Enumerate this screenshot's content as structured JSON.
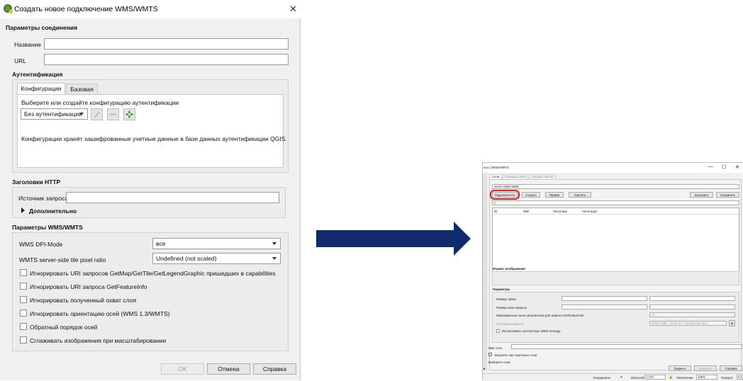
{
  "dialog": {
    "title": "Создать новое подключение WMS/WMTS",
    "connection_params": {
      "header": "Параметры соединения",
      "name_label": "Название",
      "name_value": "",
      "url_label": "URL",
      "url_value": ""
    },
    "auth": {
      "header": "Аутентификация",
      "tabs": [
        "Конфигурации",
        "Базовая"
      ],
      "choose_text": "Выберите или создайте конфигурацию аутентификации",
      "combo_value": "Без аутентификации",
      "info_text": "Конфигурации хранят зашифрованные учетные данные в базе данных аутентификации QGIS."
    },
    "http": {
      "header": "Заголовки HTTP",
      "referer_label": "Источник запроса",
      "referer_value": "",
      "more_label": "Дополнительно"
    },
    "wms": {
      "header": "Параметры WMS/WMTS",
      "dpi_label": "WMS DPI-Mode",
      "dpi_value": "все",
      "ratio_label": "WMTS server-side tile pixel ratio",
      "ratio_value": "Undefined (not scaled)",
      "checks": [
        "Игнорировать URI запросов GetMap/GetTile/GetLegendGraphic пришедших в capabilities",
        "Игнорировать URI запроса GetFeatureInfo",
        "Игнорировать полученный охват слоя",
        "Игнорировать ориентацию осей (WMS 1.3/WMTS)",
        "Обратный порядок осей",
        "Сглаживать изображения при масштабировании"
      ]
    },
    "buttons": {
      "ok": "OK",
      "cancel": "Отмена",
      "help": "Справка"
    }
  },
  "thumb": {
    "title": "ных | WMS/WMTS",
    "tabs": [
      "Слои",
      "Порядок слоёв",
      "Наборы тайлов"
    ],
    "server": "NASA GIBS WMS",
    "buttons": {
      "connect": "Подключиться",
      "create": "Создать",
      "edit": "Правка",
      "delete": "Удалить",
      "load": "Загрузить",
      "save": "Сохранить"
    },
    "columns": [
      "ID",
      "Имя",
      "Заголовок",
      "Аннотация"
    ],
    "image_format": "Формат изображения",
    "params_header": "Параметры",
    "params": {
      "tile_size": "Размер тайла",
      "step_size": "Размер шага запроса",
      "max_features": "Максимальное число результатов для запроса GetFeatureInfo",
      "max_value": "10",
      "crs_label": "Система координат",
      "crs_value": "EPSG:3857 - WGS 84 / Pseudo-Mercator",
      "legend": "Использовать контекстную WMS-легенду"
    },
    "layer_name_label": "Имя слоя",
    "load_separately": "Загрузить как отдельные слои",
    "select_layers": "Выберите слои",
    "footer": {
      "close": "Закрыть",
      "add": "Добавить",
      "help": "Справка"
    },
    "status": {
      "coords": "Координаты",
      "scale_label": "Масштаб",
      "scale_value": "1:270",
      "zoom_label": "Увеличение",
      "zoom_value": "100%",
      "rotation_label": "Поворот",
      "rotation_value": "0,0"
    }
  },
  "colors": {
    "arrow": "#102a6e",
    "highlight": "#e0201b",
    "qgis_green": "#5a9a3a"
  }
}
